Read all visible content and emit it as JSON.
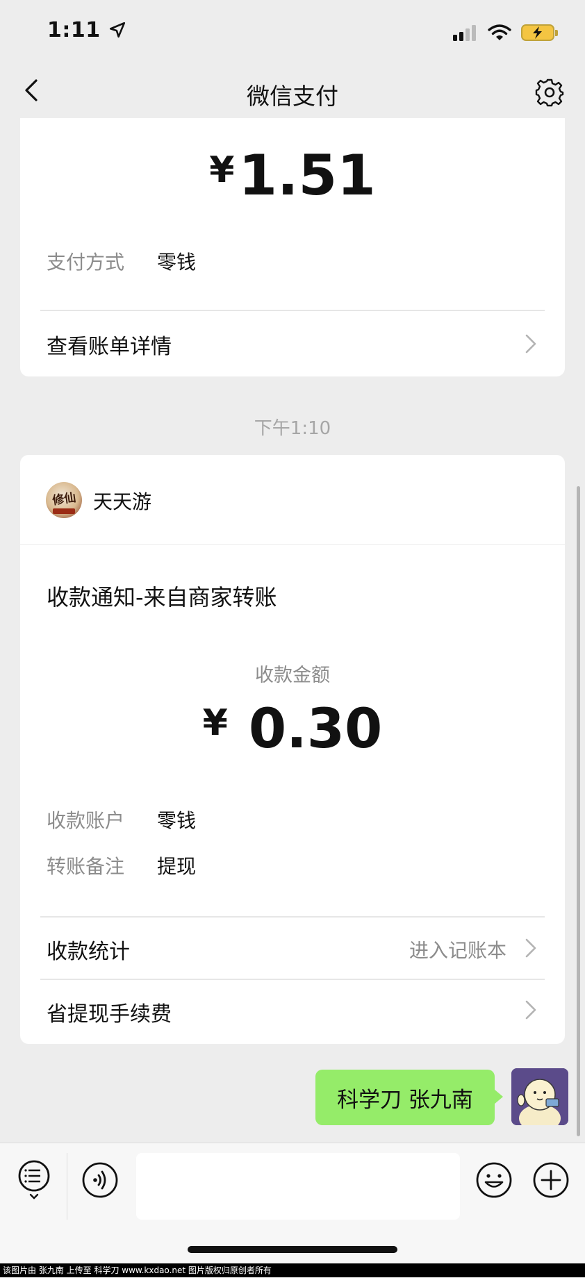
{
  "status_bar": {
    "time": "1:11"
  },
  "nav": {
    "title": "微信支付"
  },
  "card1": {
    "currency": "¥",
    "amount": "1.51",
    "method_label": "支付方式",
    "method_value": "零钱",
    "link_label": "查看账单详情"
  },
  "time_separator": "下午1:10",
  "card2": {
    "merchant_name": "天天游",
    "merchant_logo_text": "修仙",
    "notice_title": "收款通知-来自商家转账",
    "amount_label": "收款金额",
    "currency": "¥",
    "amount": "0.30",
    "account_label": "收款账户",
    "account_value": "零钱",
    "note_label": "转账备注",
    "note_value": "提现",
    "stats_label": "收款统计",
    "stats_action": "进入记账本",
    "fee_label": "省提现手续费"
  },
  "chat": {
    "my_message": "科学刀 张九南"
  },
  "footer": {
    "watermark": "该图片由 张九南 上传至 科学刀 www.kxdao.net 图片版权归原创者所有"
  },
  "colors": {
    "bubble": "#95ec69",
    "background": "#ededed",
    "battery": "#f4c542"
  },
  "icons": [
    "location-arrow-icon",
    "cellular-signal-icon",
    "wifi-icon",
    "battery-charging-icon",
    "back-chevron-icon",
    "gear-icon",
    "chevron-right-icon",
    "menu-list-icon",
    "voice-icon",
    "emoji-icon",
    "plus-icon"
  ]
}
